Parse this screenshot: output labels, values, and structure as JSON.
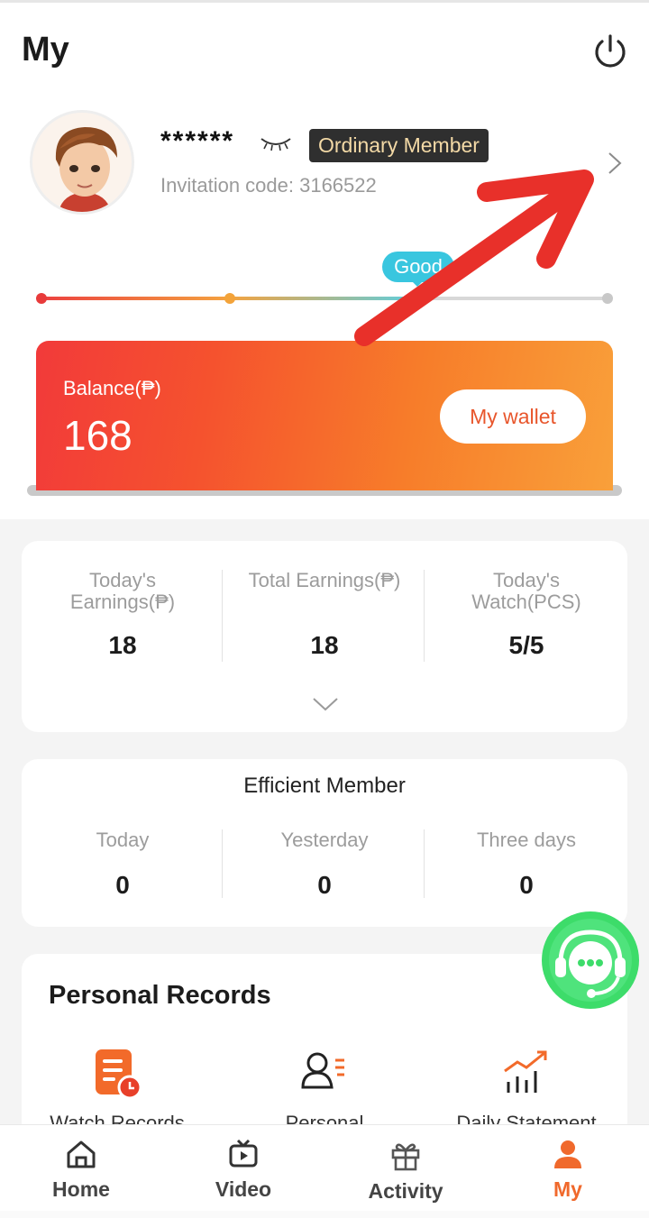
{
  "header": {
    "title": "My"
  },
  "profile": {
    "username": "******",
    "member_level": "Ordinary Member",
    "invitation_code": "Invitation code: 3166522",
    "credit_label": "Good"
  },
  "balance": {
    "label": "Balance(₱)",
    "value": "168",
    "wallet_button": "My wallet"
  },
  "earnings": {
    "columns": [
      {
        "label": "Today's Earnings(₱)",
        "value": "18"
      },
      {
        "label": "Total Earnings(₱)",
        "value": "18"
      },
      {
        "label": "Today's Watch(PCS)",
        "value": "5/5"
      }
    ]
  },
  "efficient_member": {
    "title": "Efficient Member",
    "columns": [
      {
        "label": "Today",
        "value": "0"
      },
      {
        "label": "Yesterday",
        "value": "0"
      },
      {
        "label": "Three days",
        "value": "0"
      }
    ]
  },
  "personal_records": {
    "title": "Personal Records",
    "items": [
      {
        "label": "Watch Records",
        "icon": "document-clock-icon"
      },
      {
        "label": "Personal",
        "icon": "user-list-icon"
      },
      {
        "label": "Daily Statement",
        "icon": "chart-up-icon"
      }
    ]
  },
  "bottom_nav": {
    "items": [
      {
        "label": "Home",
        "icon": "home-icon",
        "active": false
      },
      {
        "label": "Video",
        "icon": "video-icon",
        "active": false
      },
      {
        "label": "Activity",
        "icon": "gift-icon",
        "active": false
      },
      {
        "label": "My",
        "icon": "user-icon",
        "active": true
      }
    ]
  },
  "colors": {
    "accent": "#f0692c",
    "balance_gradient_start": "#f23a3a",
    "balance_gradient_end": "#f9a03a",
    "credit_tag": "#39c6df",
    "support_green": "#3ddc6a",
    "annotation_arrow": "#e8302a"
  }
}
